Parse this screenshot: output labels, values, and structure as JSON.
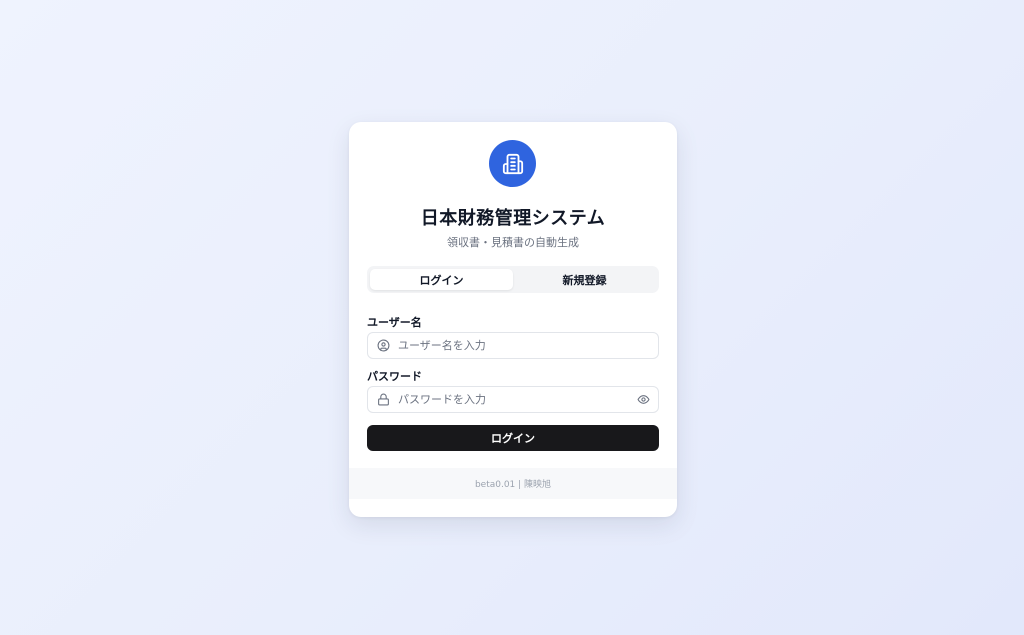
{
  "app": {
    "title": "日本財務管理システム",
    "subtitle": "領収書・見積書の自動生成",
    "logo_icon": "building-icon",
    "accent_color": "#2f64df"
  },
  "tabs": [
    {
      "label": "ログイン",
      "active": true
    },
    {
      "label": "新規登録",
      "active": false
    }
  ],
  "form": {
    "username": {
      "label": "ユーザー名",
      "placeholder": "ユーザー名を入力",
      "value": "",
      "icon": "user-circle-icon"
    },
    "password": {
      "label": "パスワード",
      "placeholder": "パスワードを入力",
      "value": "",
      "icon": "lock-icon",
      "toggle_icon": "eye-icon"
    },
    "submit_label": "ログイン",
    "submit_color": "#18181b"
  },
  "footer": {
    "text": "beta0.01 | 陳映旭"
  }
}
